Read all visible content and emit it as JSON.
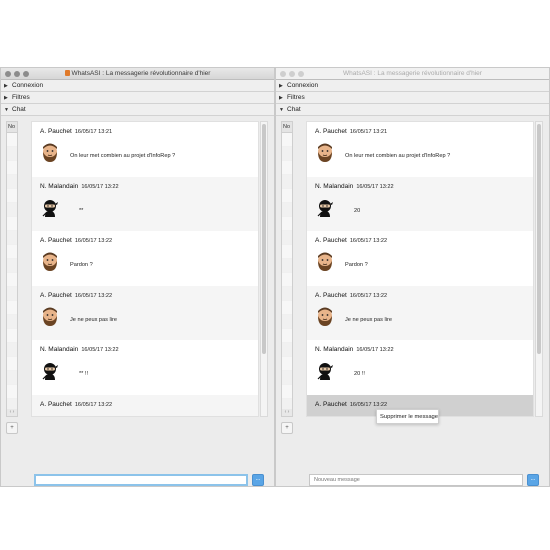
{
  "windows": {
    "left": {
      "title": "WhatsASI : La messagerie révolutionnaire d'hier"
    },
    "right": {
      "title": "WhatsASI : La messagerie révolutionnaire d'hier"
    }
  },
  "sections": {
    "connexion": "Connexion",
    "filtres": "Filtres",
    "chat": "Chat"
  },
  "side_list": {
    "header": "No",
    "add_button": "+"
  },
  "left_messages": [
    {
      "author": "A. Pauchet",
      "time": "16/05/17 13:21",
      "text": "On leur met combien au projet d'InfoRep ?",
      "avatar": "bearded-man-avatar"
    },
    {
      "author": "N. Malandain",
      "time": "16/05/17 13:22",
      "text": "**",
      "avatar": "ninja-avatar"
    },
    {
      "author": "A. Pauchet",
      "time": "16/05/17 13:22",
      "text": "Pardon ?",
      "avatar": "bearded-man-avatar"
    },
    {
      "author": "A. Pauchet",
      "time": "16/05/17 13:22",
      "text": "Je ne peux pas lire",
      "avatar": "bearded-man-avatar"
    },
    {
      "author": "N. Malandain",
      "time": "16/05/17 13:22",
      "text": "** !!",
      "avatar": "ninja-avatar"
    },
    {
      "author": "A. Pauchet",
      "time": "16/05/17 13:22",
      "text": "",
      "avatar": "bearded-man-avatar"
    }
  ],
  "right_messages": [
    {
      "author": "A. Pauchet",
      "time": "16/05/17 13:21",
      "text": "On leur met combien au projet d'InfoRep ?",
      "avatar": "bearded-man-avatar"
    },
    {
      "author": "N. Malandain",
      "time": "16/05/17 13:22",
      "text": "20",
      "avatar": "ninja-avatar"
    },
    {
      "author": "A. Pauchet",
      "time": "16/05/17 13:22",
      "text": "Pardon ?",
      "avatar": "bearded-man-avatar"
    },
    {
      "author": "A. Pauchet",
      "time": "16/05/17 13:22",
      "text": "Je ne peux pas lire",
      "avatar": "bearded-man-avatar"
    },
    {
      "author": "N. Malandain",
      "time": "16/05/17 13:22",
      "text": "20 !!",
      "avatar": "ninja-avatar"
    },
    {
      "author": "A. Pauchet",
      "time": "16/05/17 13:22",
      "text": "",
      "avatar": "bearded-man-avatar"
    }
  ],
  "left_input": {
    "value": "",
    "placeholder": ""
  },
  "right_input": {
    "value": "",
    "placeholder": "Nouveau message"
  },
  "send_button": "...",
  "context_menu": {
    "item": "Supprimer le message"
  },
  "colors": {
    "accent": "#5aa5e6",
    "focus_ring": "#8cc3ea",
    "selected_row": "#d0d0d0"
  }
}
